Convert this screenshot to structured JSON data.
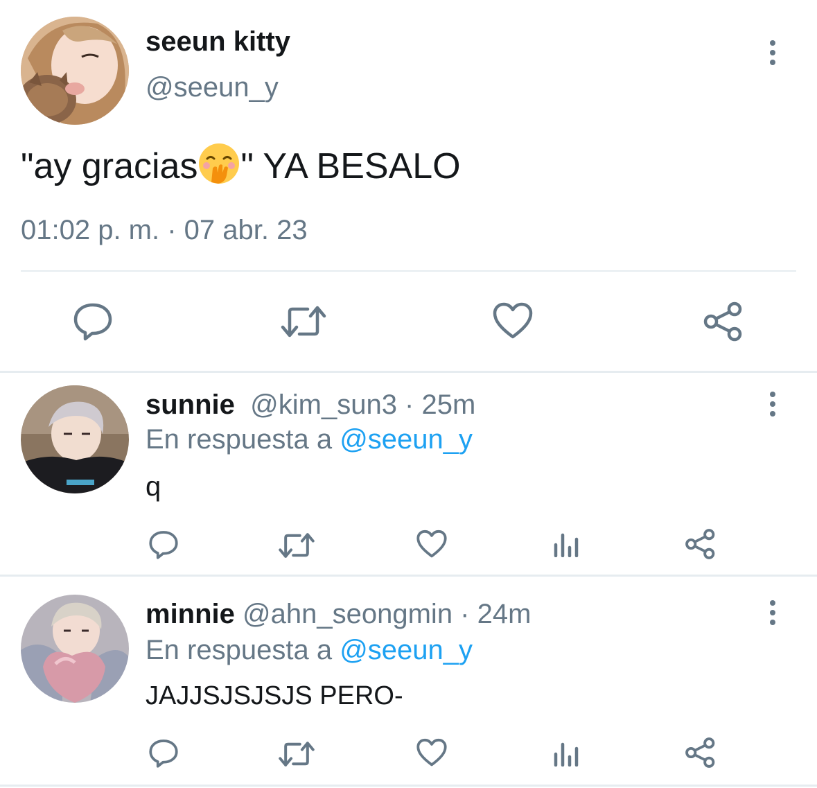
{
  "main_tweet": {
    "display_name": "seeun kitty",
    "handle": "@seeun_y",
    "text_before_emoji": "\"ay gracias",
    "emoji": "hand-over-mouth-emoji",
    "text_after_emoji": "\" YA BESALO",
    "timestamp": "01:02 p. m. · 07 abr. 23",
    "actions": [
      "reply-icon",
      "retweet-icon",
      "like-icon",
      "share-icon"
    ]
  },
  "replies": [
    {
      "display_name": "sunnie",
      "handle": "@kim_sun3",
      "time": " · 25m",
      "in_reply_label": "En respuesta a ",
      "in_reply_to": "@seeun_y",
      "text": "q",
      "actions": [
        "reply-icon",
        "retweet-icon",
        "like-icon",
        "stats-icon",
        "share-icon"
      ]
    },
    {
      "display_name": "minnie",
      "handle": "@ahn_seongmin",
      "time": " · 24m",
      "in_reply_label": "En respuesta a ",
      "in_reply_to": "@seeun_y",
      "text": "JAJJSJSJSJS PERO-",
      "actions": [
        "reply-icon",
        "retweet-icon",
        "like-icon",
        "stats-icon",
        "share-icon"
      ]
    }
  ],
  "colors": {
    "text": "#14171a",
    "secondary": "#657786",
    "link": "#1da1f2",
    "divider": "#e6ecf0"
  }
}
